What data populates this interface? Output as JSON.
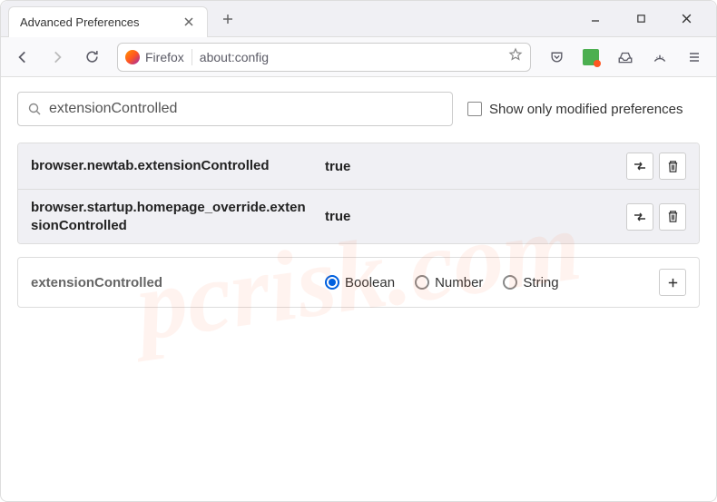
{
  "window": {
    "tab_title": "Advanced Preferences"
  },
  "urlbar": {
    "firefox_label": "Firefox",
    "url_text": "about:config"
  },
  "search": {
    "value": "extensionControlled",
    "checkbox_label": "Show only modified preferences"
  },
  "prefs": [
    {
      "name": "browser.newtab.extensionControlled",
      "value": "true"
    },
    {
      "name": "browser.startup.homepage_override.extensionControlled",
      "value": "true"
    }
  ],
  "new_pref": {
    "name": "extensionControlled",
    "options": [
      "Boolean",
      "Number",
      "String"
    ],
    "selected": "Boolean"
  },
  "watermark": "pcrisk.com"
}
